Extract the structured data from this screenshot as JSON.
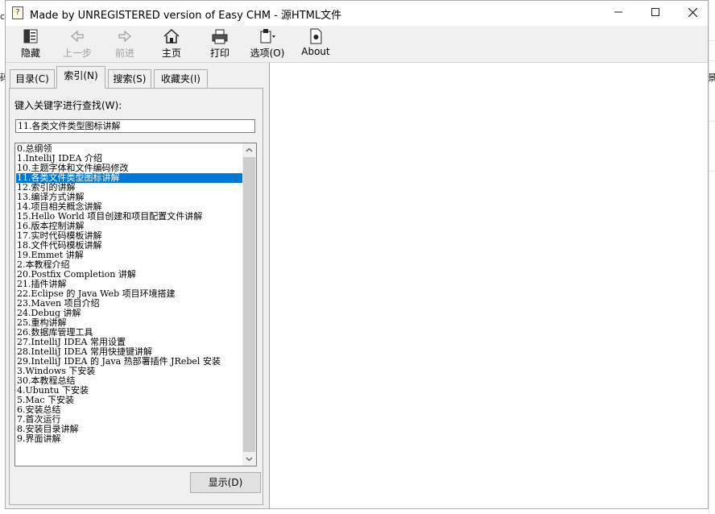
{
  "window": {
    "title": "Made by UNREGISTERED version of Easy CHM - 源HTML文件"
  },
  "toolbar": {
    "hide": "隐藏",
    "back": "上一步",
    "forward": "前进",
    "home": "主页",
    "print": "打印",
    "options": "选项(O)",
    "about": "About"
  },
  "tabs": {
    "contents": "目录(C)",
    "index": "索引(N)",
    "search": "搜索(S)",
    "favorites": "收藏夹(I)"
  },
  "index_panel": {
    "keyword_label": "键入关键字进行查找(W):",
    "keyword_value": "11.各类文件类型图标讲解",
    "show_button": "显示(D)",
    "selected_index": 3,
    "items": [
      "0.总纲领",
      "1.IntelliJ IDEA 介绍",
      "10.主题字体和文件编码修改",
      "11.各类文件类型图标讲解",
      "12.索引的讲解",
      "13.编译方式讲解",
      "14.项目相关概念讲解",
      "15.Hello World 项目创建和项目配置文件讲解",
      "16.版本控制讲解",
      "17.实时代码模板讲解",
      "18.文件代码模板讲解",
      "19.Emmet 讲解",
      "2.本教程介绍",
      "20.Postfix Completion 讲解",
      "21.插件讲解",
      "22.Eclipse 的 Java Web 项目环境搭建",
      "23.Maven 项目介绍",
      "24.Debug 讲解",
      "25.重构讲解",
      "26.数据库管理工具",
      "27.IntelliJ IDEA 常用设置",
      "28.IntelliJ IDEA 常用快捷键讲解",
      "29.IntelliJ IDEA 的 Java 热部署插件 JRebel 安装",
      "3.Windows 下安装",
      "30.本教程总结",
      "4.Ubuntu 下安装",
      "5.Mac 下安装",
      "6.安装总结",
      "7.首次运行",
      "8.安装目录讲解",
      "9.界面讲解"
    ]
  },
  "background_window": {
    "left_edge_1": "c",
    "left_edge_2": "码",
    "right_edge": "景"
  },
  "colors": {
    "selection": "#0078d7",
    "chrome": "#f0f0f0"
  }
}
